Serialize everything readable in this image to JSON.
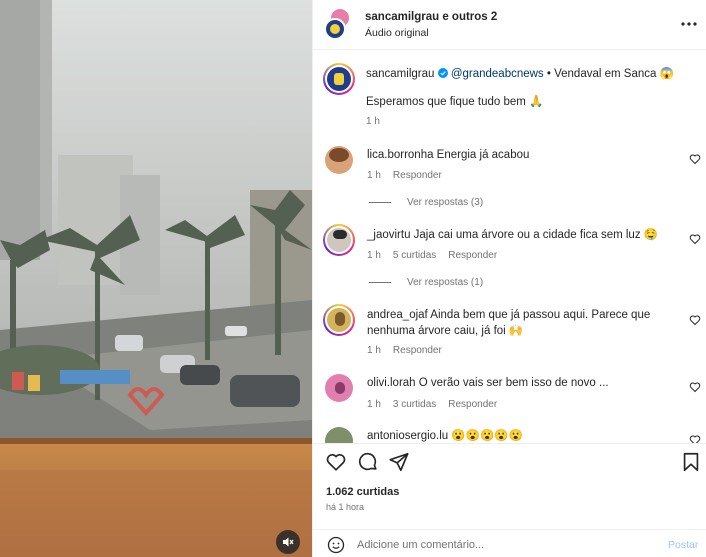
{
  "post": {
    "header": {
      "username": "sancamilgrau e outros 2",
      "audio": "Áudio original"
    },
    "caption": {
      "username": "sancamilgrau",
      "mention": "@grandeabcnews",
      "text": " • Vendaval em Sanca 😱",
      "line2": "Esperamos que fique tudo bem 🙏",
      "time": "1 h"
    },
    "comments": [
      {
        "username": "lica.borronha",
        "text": " Energia já acabou",
        "time": "1 h",
        "likes": "",
        "reply_label": "Responder",
        "view_replies": "Ver respostas (3)"
      },
      {
        "username": "_jaovirtu",
        "text": " Jaja cai uma árvore ou a cidade fica sem luz 🤤",
        "time": "1 h",
        "likes": "5 curtidas",
        "reply_label": "Responder",
        "view_replies": "Ver respostas (1)"
      },
      {
        "username": "andrea_ojaf",
        "text": " Ainda bem que já passou aqui. Parece que nenhuma árvore caiu, já foi 🙌",
        "time": "1 h",
        "likes": "",
        "reply_label": "Responder"
      },
      {
        "username": "olivi.lorah",
        "text": " O verão vais ser bem isso de novo ...",
        "time": "1 h",
        "likes": "3 curtidas",
        "reply_label": "Responder"
      },
      {
        "username": "antoniosergio.lu",
        "text": " 😮😮😮😮😮"
      }
    ],
    "likes_count": "1.062 curtidas",
    "posted_time": "há 1 hora",
    "composer": {
      "placeholder": "Adicione um comentário...",
      "post_label": "Postar"
    }
  },
  "icons": {
    "more": "more-options-icon",
    "like": "heart-icon",
    "comment": "comment-icon",
    "share": "paper-plane-icon",
    "save": "bookmark-icon",
    "mute": "speaker-muted-icon",
    "emoji": "smiley-icon"
  },
  "colors": {
    "mention": "#00376b",
    "muted_text": "#737373",
    "post_button": "#9cc4f5",
    "story_ring": "#d62976"
  }
}
